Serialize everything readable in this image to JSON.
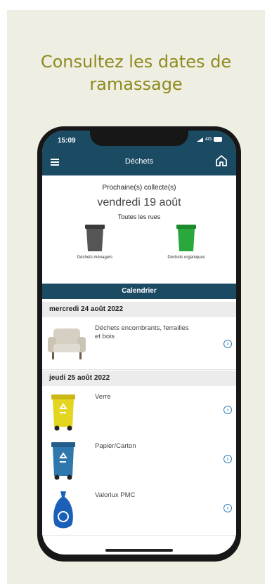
{
  "headline": {
    "line1": "Consultez les dates de",
    "line2": "ramassage"
  },
  "status": {
    "time": "15:09",
    "network": "4G"
  },
  "header": {
    "title": "Déchets"
  },
  "next": {
    "label": "Prochaine(s) collecte(s)",
    "date": "vendredi 19 août",
    "streets": "Toutes les rues",
    "bins": [
      {
        "label": "Déchets ménagers",
        "color": "#4a4a4a"
      },
      {
        "label": "Déchets organiques",
        "color": "#27a33a"
      }
    ]
  },
  "calendar": {
    "title": "Calendrier",
    "days": [
      {
        "date": "mercredi 24 août 2022",
        "items": [
          {
            "label": "Déchets encombrants, ferrailles et bois",
            "icon": "armchair-icon"
          }
        ]
      },
      {
        "date": "jeudi 25 août 2022",
        "items": [
          {
            "label": "Verre",
            "icon": "yellow-bin-icon",
            "color": "#e2d320"
          },
          {
            "label": "Papier/Carton",
            "icon": "blue-bin-icon",
            "color": "#2f78ad"
          },
          {
            "label": "Valorlux PMC",
            "icon": "blue-bag-icon",
            "color": "#1a5fb8"
          }
        ]
      }
    ]
  },
  "colors": {
    "header": "#1b4a63",
    "accent": "#8e8a1e",
    "chevron": "#2d7fb8"
  }
}
